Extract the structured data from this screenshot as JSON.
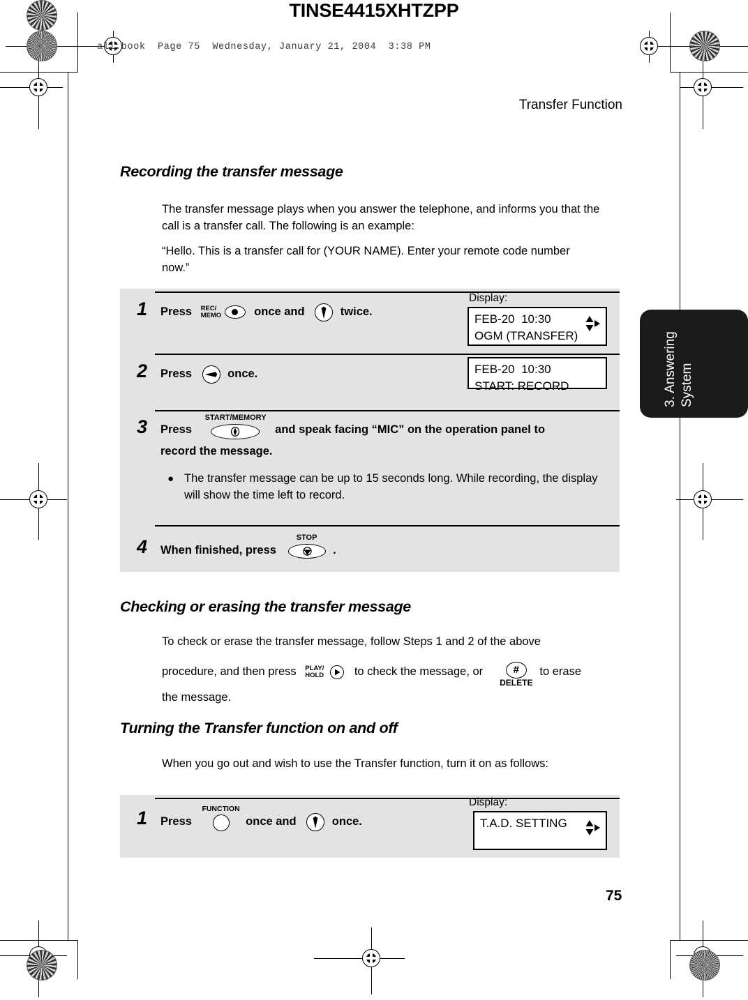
{
  "print_marks": {
    "doc_code": "TINSE4415XHTZPP",
    "file_header": "all.book  Page 75  Wednesday, January 21, 2004  3:38 PM"
  },
  "running_head": "Transfer Function",
  "page_number": "75",
  "side_tab": {
    "line1": "3. Answering",
    "line2": "System"
  },
  "sections": {
    "recording": {
      "heading": "Recording the transfer message",
      "para1": "The transfer message plays when you answer the telephone, and informs you that the call is a transfer call. The following is an example:",
      "para2": "“Hello. This is a transfer call for (YOUR NAME). Enter your remote code number now.”"
    },
    "checking": {
      "heading": "Checking or erasing the transfer message",
      "text_a": "To check or erase the transfer message, follow Steps 1 and 2 of the above",
      "text_b": "procedure, and then press",
      "text_c": "to check the message, or",
      "text_d": "to erase",
      "text_e": "the message."
    },
    "turning": {
      "heading": "Turning the Transfer function on and off",
      "para": "When you go out and wish to use the Transfer function, turn it on as follows:"
    }
  },
  "procedure_record": {
    "display_label": "Display:",
    "steps": [
      {
        "num": "1",
        "text_a": "Press",
        "key1": {
          "name": "rec-memo-key",
          "label_line1": "REC/",
          "label_line2": "MEMO",
          "glyph": "oval-dot"
        },
        "text_b": "once and",
        "key2": {
          "name": "down-arrow-key",
          "glyph": "circle-down-triangle"
        },
        "text_c": "twice.",
        "lcd": {
          "line1": "FEB-20  10:30",
          "line2": "OGM (TRANSFER)",
          "nav": true
        }
      },
      {
        "num": "2",
        "text_a": "Press",
        "key1": {
          "name": "play-key",
          "glyph": "circle-right-triangle"
        },
        "text_b": "once.",
        "lcd": {
          "line1": "FEB-20  10:30",
          "line2": "START: RECORD",
          "nav": false
        }
      },
      {
        "num": "3",
        "text_a": "Press",
        "key1": {
          "name": "start-memory-key",
          "label_line1": "START/MEMORY",
          "glyph": "oval-diamond"
        },
        "text_b": "and speak facing “MIC” on the operation panel to",
        "text_c": "record the message.",
        "bullet": "The transfer message can be up to 15 seconds long. While recording, the display will show the time left to record."
      },
      {
        "num": "4",
        "text_a": "When finished, press",
        "key1": {
          "name": "stop-key",
          "label_line1": "STOP",
          "glyph": "oval-stop"
        },
        "text_b": "."
      }
    ]
  },
  "procedure_turning": {
    "display_label": "Display:",
    "steps": [
      {
        "num": "1",
        "text_a": "Press",
        "key1": {
          "name": "function-key",
          "label_line1": "FUNCTION",
          "glyph": "circle-plain"
        },
        "text_b": "once and",
        "key2": {
          "name": "down-arrow-key",
          "glyph": "circle-down-triangle"
        },
        "text_c": "once.",
        "lcd": {
          "line1": "T.A.D. SETTING",
          "line2": "",
          "nav": true
        }
      }
    ]
  },
  "inline_keys": {
    "play_hold": {
      "label_line1": "PLAY/",
      "label_line2": "HOLD",
      "glyph": "circle-right-triangle-small"
    },
    "delete": {
      "glyph": "hash",
      "symbol": "#",
      "sublabel": "DELETE"
    }
  },
  "colors": {
    "step_bg": "#e3e3e3",
    "tab_bg": "#1a1a1a",
    "ink": "#000000"
  }
}
